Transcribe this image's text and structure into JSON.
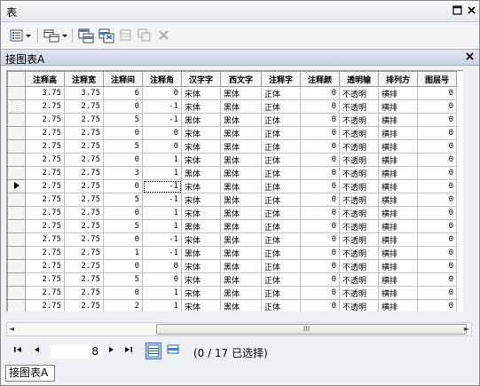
{
  "window": {
    "title": "表"
  },
  "toolbar": {
    "items": [
      {
        "icon": "table-options-icon"
      },
      {
        "icon": "related-tables-icon"
      },
      {
        "icon": "select-by-attributes-icon"
      },
      {
        "icon": "switch-selection-icon"
      },
      {
        "icon": "clear-selection-icon"
      },
      {
        "icon": "zoom-to-selected-icon"
      },
      {
        "icon": "delete-selected-icon"
      }
    ]
  },
  "table_tab": {
    "label": "接图表A"
  },
  "grid": {
    "columns": [
      "注释高",
      "注释宽",
      "注释间",
      "注释角",
      "汉字字",
      "西文字",
      "注释字",
      "注释颜",
      "透明输",
      "排列方",
      "图层号"
    ],
    "current_row_index": 7,
    "rows": [
      [
        "3.75",
        "3.75",
        "6",
        "0",
        "宋体",
        "黑体",
        "正体",
        "0",
        "不透明",
        "横排",
        "0"
      ],
      [
        "2.75",
        "2.75",
        "0",
        "-1",
        "宋体",
        "黑体",
        "正体",
        "0",
        "不透明",
        "横排",
        "0"
      ],
      [
        "2.75",
        "2.75",
        "5",
        "-1",
        "黑体",
        "黑体",
        "正体",
        "0",
        "不透明",
        "横排",
        "0"
      ],
      [
        "2.75",
        "2.75",
        "0",
        "0",
        "宋体",
        "黑体",
        "正体",
        "0",
        "不透明",
        "横排",
        "0"
      ],
      [
        "2.75",
        "2.75",
        "5",
        "0",
        "宋体",
        "黑体",
        "正体",
        "0",
        "不透明",
        "横排",
        "0"
      ],
      [
        "2.75",
        "2.75",
        "0",
        "1",
        "宋体",
        "黑体",
        "正体",
        "0",
        "不透明",
        "横排",
        "0"
      ],
      [
        "2.75",
        "2.75",
        "3",
        "1",
        "黑体",
        "黑体",
        "正体",
        "0",
        "不透明",
        "横排",
        "0"
      ],
      [
        "2.75",
        "2.75",
        "0",
        "-1",
        "宋体",
        "黑体",
        "正体",
        "0",
        "不透明",
        "横排",
        "0"
      ],
      [
        "2.75",
        "2.75",
        "5",
        "-1",
        "宋体",
        "黑体",
        "正体",
        "0",
        "不透明",
        "横排",
        "0"
      ],
      [
        "2.75",
        "2.75",
        "0",
        "1",
        "宋体",
        "黑体",
        "正体",
        "0",
        "不透明",
        "横排",
        "0"
      ],
      [
        "2.75",
        "2.75",
        "5",
        "1",
        "黑体",
        "黑体",
        "正体",
        "0",
        "不透明",
        "横排",
        "0"
      ],
      [
        "2.75",
        "2.75",
        "0",
        "-1",
        "宋体",
        "黑体",
        "正体",
        "0",
        "不透明",
        "横排",
        "0"
      ],
      [
        "2.75",
        "2.75",
        "1",
        "-1",
        "黑体",
        "黑体",
        "正体",
        "0",
        "不透明",
        "横排",
        "0"
      ],
      [
        "2.75",
        "2.75",
        "0",
        "0",
        "宋体",
        "黑体",
        "正体",
        "0",
        "不透明",
        "横排",
        "0"
      ],
      [
        "2.75",
        "2.75",
        "5",
        "0",
        "宋体",
        "黑体",
        "正体",
        "0",
        "不透明",
        "横排",
        "0"
      ],
      [
        "2.75",
        "2.75",
        "0",
        "1",
        "宋体",
        "黑体",
        "正体",
        "0",
        "不透明",
        "横排",
        "0"
      ],
      [
        "2.75",
        "2.75",
        "2",
        "1",
        "宋体",
        "黑体",
        "正体",
        "0",
        "不透明",
        "横排",
        "0"
      ]
    ]
  },
  "scrollbar": {
    "thumb_grip": "III"
  },
  "navigation": {
    "current_record": "8",
    "status": "(0 / 17 已选择)"
  },
  "bottom_tab": {
    "label": "接图表A"
  }
}
